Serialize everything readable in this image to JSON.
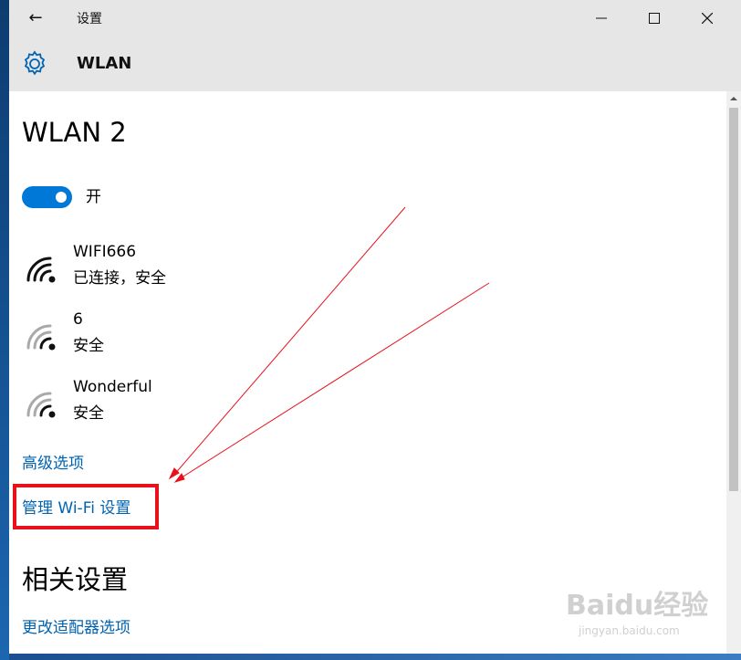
{
  "window": {
    "title": "设置",
    "back_label": "←"
  },
  "header": {
    "title": "WLAN"
  },
  "wlan": {
    "section_title": "WLAN 2",
    "toggle": {
      "state": "开",
      "on": true
    },
    "networks": [
      {
        "name": "WIFI666",
        "status": "已连接，安全",
        "connected": true
      },
      {
        "name": "6",
        "status": "安全",
        "connected": false
      },
      {
        "name": "Wonderful",
        "status": "安全",
        "connected": false
      }
    ],
    "advanced_link": "高级选项",
    "manage_link": "管理 Wi-Fi 设置"
  },
  "related": {
    "section_title": "相关设置",
    "adapter_link": "更改适配器选项"
  },
  "watermark": {
    "main": "Baidu经验",
    "sub": "jingyan.baidu.com"
  },
  "colors": {
    "accent": "#0078d7",
    "link": "#0063b1",
    "annotation": "#e8101a",
    "chrome": "#e6e6e6"
  },
  "icons": [
    "back-arrow-icon",
    "minimize-icon",
    "maximize-icon",
    "close-icon",
    "gear-icon",
    "wifi-signal-icon"
  ]
}
